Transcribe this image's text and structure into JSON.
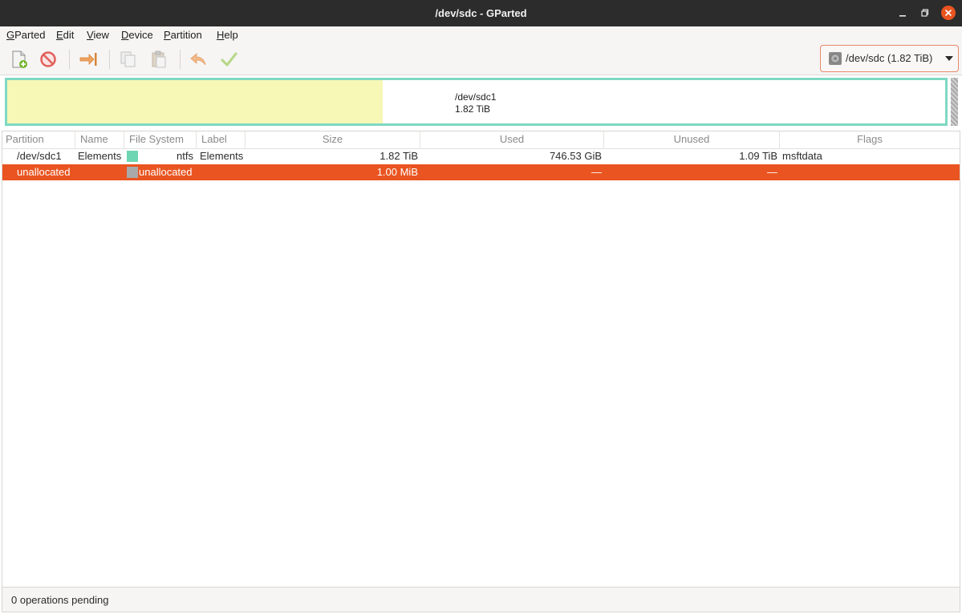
{
  "window": {
    "title": "/dev/sdc - GParted"
  },
  "menu": {
    "items": [
      {
        "label": "GParted",
        "accel": "G"
      },
      {
        "label": "Edit",
        "accel": "E"
      },
      {
        "label": "View",
        "accel": "V"
      },
      {
        "label": "Device",
        "accel": "D"
      },
      {
        "label": "Partition",
        "accel": "P"
      },
      {
        "label": "Help",
        "accel": "H"
      }
    ]
  },
  "toolbar": {
    "buttons": [
      {
        "name": "new-partition",
        "icon": "new-document-plus-icon",
        "enabled": true
      },
      {
        "name": "delete-partition",
        "icon": "prohibit-icon",
        "enabled": true
      },
      {
        "name": "resize-move",
        "icon": "arrow-right-bar-icon",
        "enabled": true
      },
      {
        "name": "copy",
        "icon": "copy-icon",
        "enabled": false
      },
      {
        "name": "paste",
        "icon": "paste-icon",
        "enabled": false
      },
      {
        "name": "undo",
        "icon": "undo-arrow-icon",
        "enabled": false
      },
      {
        "name": "apply",
        "icon": "checkmark-icon",
        "enabled": false
      }
    ]
  },
  "device_selector": {
    "label": "/dev/sdc  (1.82 TiB)",
    "icon": "hard-disk-icon"
  },
  "disk_map": {
    "partition_name": "/dev/sdc1",
    "partition_size": "1.82 TiB",
    "used_fraction": 0.4,
    "border_color": "#7ed9c3",
    "used_color": "#f7f7b6"
  },
  "table": {
    "columns": [
      "Partition",
      "Name",
      "File System",
      "Label",
      "Size",
      "Used",
      "Unused",
      "Flags"
    ],
    "rows": [
      {
        "partition": "/dev/sdc1",
        "name": "Elements",
        "fs_color": "#6fd6b3",
        "filesystem": "ntfs",
        "label": "Elements",
        "size": "1.82 TiB",
        "used": "746.53 GiB",
        "unused": "1.09 TiB",
        "flags": "msftdata",
        "selected": false
      },
      {
        "partition": "unallocated",
        "name": "",
        "fs_color": "#a9a9a9",
        "filesystem": "unallocated",
        "label": "",
        "size": "1.00 MiB",
        "used": "—",
        "unused": "—",
        "flags": "",
        "selected": true
      }
    ]
  },
  "status": {
    "text": "0 operations pending"
  },
  "colors": {
    "accent": "#e95420",
    "titlebar": "#2c2c2c"
  }
}
